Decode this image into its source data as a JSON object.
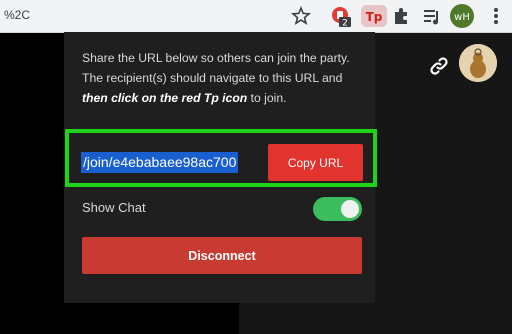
{
  "browser": {
    "url_fragment": "%2C",
    "tp_extension_label": "Tp",
    "notification_badge": "2",
    "profile_chip_label": "wH"
  },
  "popup": {
    "share_text": "Share the URL below so others can join the party. The recipient(s) should navigate to this URL and",
    "share_text_emphasis": "then click on the red Tp icon",
    "share_text_end": "to join.",
    "party_url": "/join/e4ebabaee98ac700",
    "copy_button_label": "Copy URL",
    "show_chat_label": "Show Chat",
    "show_chat_enabled": true,
    "disconnect_button_label": "Disconnect"
  },
  "colors": {
    "highlight_border": "#21d21a",
    "copy_button": "#e3332e",
    "toggle_on": "#3cbd5d",
    "disconnect_button": "#c93a33",
    "selection": "#1a5fd0"
  }
}
